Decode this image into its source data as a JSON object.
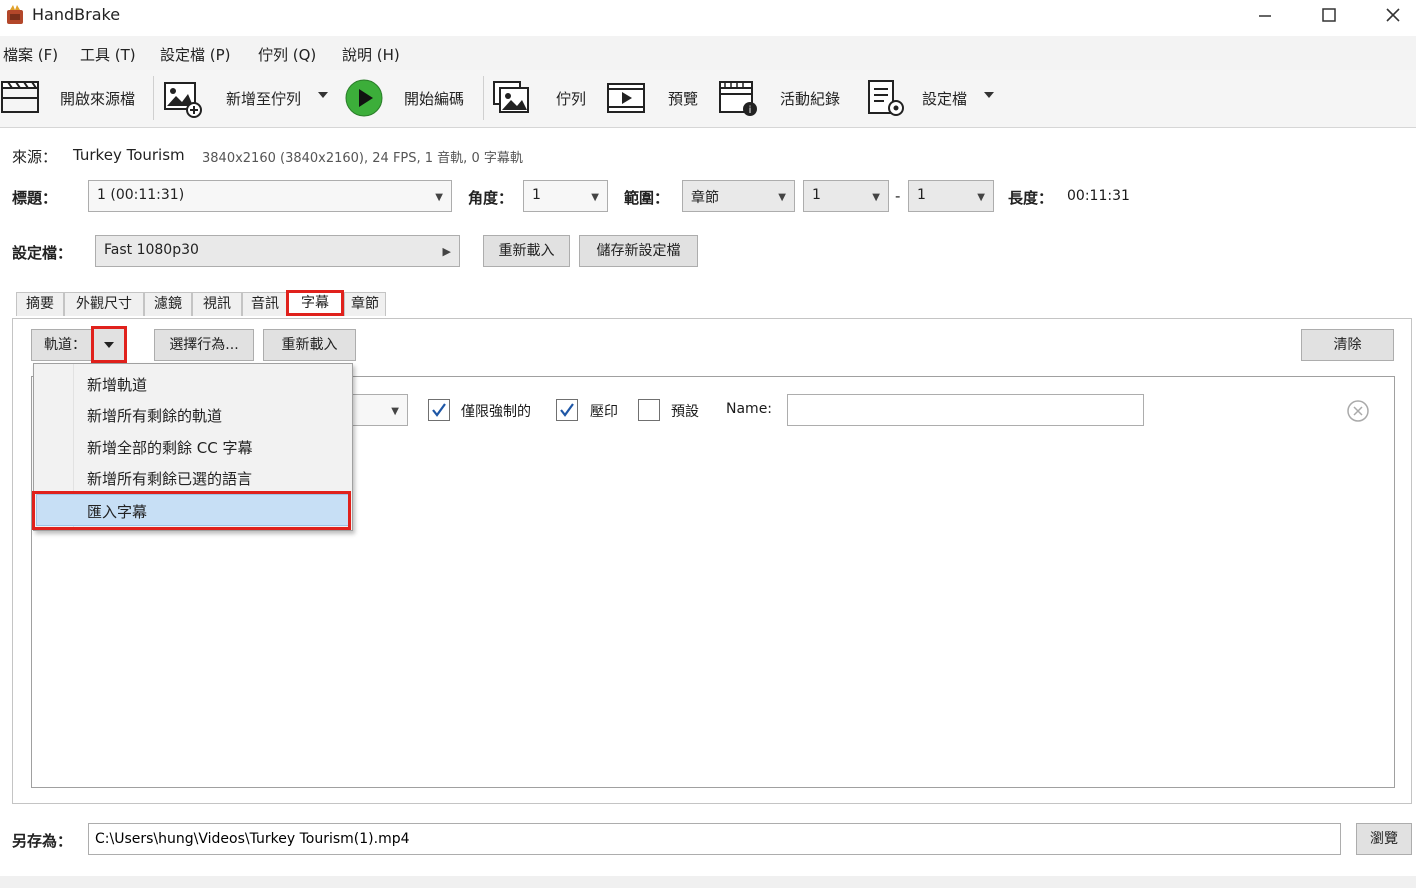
{
  "window": {
    "title": "HandBrake",
    "minimize": "—",
    "maximize": "☐",
    "close": "✕"
  },
  "menu": [
    "檔案 (F)",
    "工具 (T)",
    "設定檔 (P)",
    "佇列 (Q)",
    "說明 (H)"
  ],
  "toolbar": {
    "open_source": "開啟來源檔",
    "add_to_queue": "新增至佇列",
    "start_encode": "開始編碼",
    "queue": "佇列",
    "preview": "預覽",
    "activity_log": "活動紀錄",
    "presets": "設定檔"
  },
  "source": {
    "label": "來源：",
    "name": "Turkey Tourism",
    "info": "3840x2160 (3840x2160), 24 FPS, 1 音軌, 0 字幕軌"
  },
  "title_row": {
    "title_label": "標題：",
    "title_value": "1  (00:11:31)",
    "angle_label": "角度：",
    "angle_value": "1",
    "range_label": "範圍：",
    "range_type": "章節",
    "range_start": "1",
    "range_dash": "-",
    "range_end": "1",
    "duration_label": "長度：",
    "duration_value": "00:11:31"
  },
  "preset_row": {
    "label": "設定檔：",
    "value": "Fast 1080p30",
    "reload": "重新載入",
    "save_new": "儲存新設定檔"
  },
  "tabs": [
    "摘要",
    "外觀尺寸",
    "濾鏡",
    "視訊",
    "音訊",
    "字幕",
    "章節"
  ],
  "active_tab": "字幕",
  "subtitles": {
    "tracks_label": "軌道：",
    "select_behavior": "選擇行為...",
    "reload": "重新載入",
    "clear": "清除",
    "forced_only": "僅限強制的",
    "burn_in": "壓印",
    "default": "預設",
    "name_label": "Name:",
    "name_value": "",
    "forced_checked": true,
    "burn_checked": true,
    "default_checked": false
  },
  "dropdown": {
    "items": [
      "新增軌道",
      "新增所有剩餘的軌道",
      "新增全部的剩餘 CC 字幕",
      "新增所有剩餘已選的語言",
      "匯入字幕"
    ],
    "highlighted": "匯入字幕"
  },
  "save_as": {
    "label": "另存為：",
    "path": "C:\\Users\\hung\\Videos\\Turkey Tourism(1).mp4",
    "browse": "瀏覽"
  },
  "colors": {
    "highlight_box": "#e0211c",
    "menu_highlight": "#c7dff5",
    "start_green": "#3cae3a"
  }
}
